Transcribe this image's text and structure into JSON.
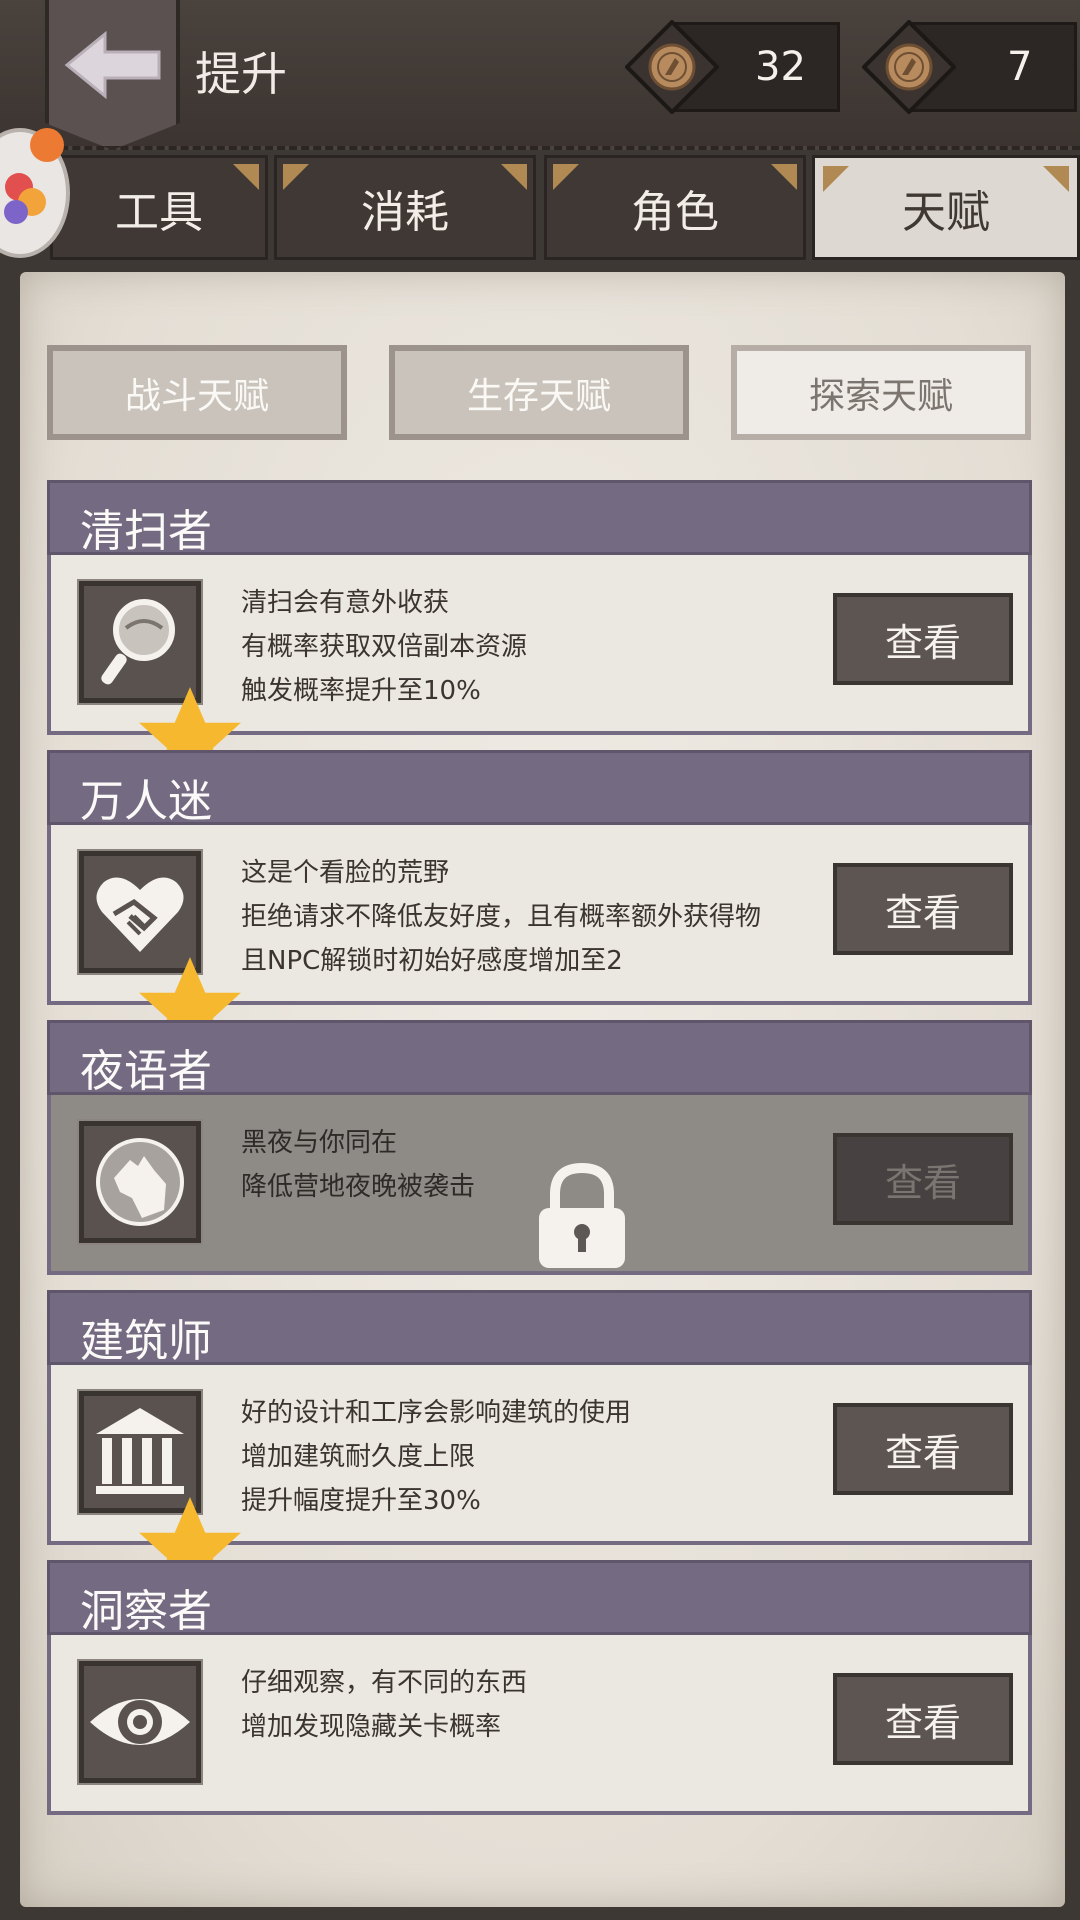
{
  "header": {
    "title": "提升",
    "currency": [
      {
        "icon": "bronze-coin-icon",
        "value": "32"
      },
      {
        "icon": "bronze-coin-icon",
        "value": "7"
      }
    ]
  },
  "main_tabs": [
    {
      "label": "工具",
      "active": false
    },
    {
      "label": "消耗",
      "active": false
    },
    {
      "label": "角色",
      "active": false
    },
    {
      "label": "天赋",
      "active": true
    }
  ],
  "sub_tabs": [
    {
      "label": "战斗天赋",
      "active": false
    },
    {
      "label": "生存天赋",
      "active": false
    },
    {
      "label": "探索天赋",
      "active": true
    }
  ],
  "talents": [
    {
      "name": "清扫者",
      "icon": "magnifier-icon",
      "starred": true,
      "locked": false,
      "lines": [
        "清扫会有意外收获",
        "有概率获取双倍副本资源",
        "触发概率提升至10%"
      ],
      "button": "查看"
    },
    {
      "name": "万人迷",
      "icon": "heart-handshake-icon",
      "starred": true,
      "locked": false,
      "lines": [
        "这是个看脸的荒野",
        "拒绝请求不降低友好度，且有概率额外获得物",
        "且NPC解锁时初始好感度增加至2"
      ],
      "button": "查看"
    },
    {
      "name": "夜语者",
      "icon": "wolf-howling-icon",
      "starred": false,
      "locked": true,
      "lines": [
        "黑夜与你同在",
        "降低营地夜晚被袭击"
      ],
      "button": "查看"
    },
    {
      "name": "建筑师",
      "icon": "building-columns-icon",
      "starred": true,
      "locked": false,
      "lines": [
        "好的设计和工序会影响建筑的使用",
        "增加建筑耐久度上限",
        "提升幅度提升至30%"
      ],
      "button": "查看"
    },
    {
      "name": "洞察者",
      "icon": "eye-icon",
      "starred": false,
      "locked": false,
      "lines": [
        "仔细观察，有不同的东西",
        "增加发现隐藏关卡概率"
      ],
      "button": "查看"
    }
  ],
  "colors": {
    "card_header": "#746b82",
    "button": "#5d5552",
    "star": "#f5b82e"
  }
}
